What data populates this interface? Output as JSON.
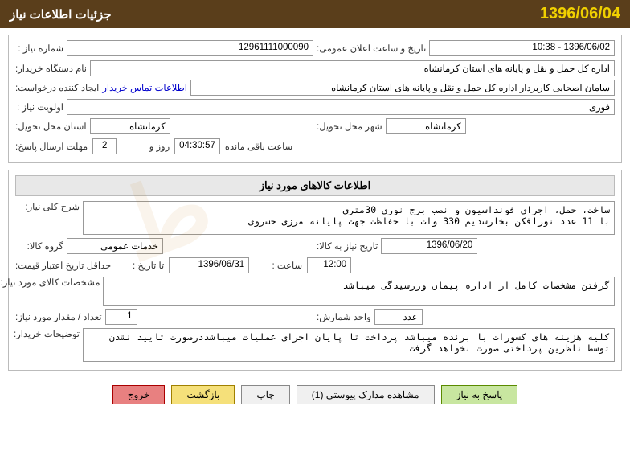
{
  "header": {
    "date": "1396/06/04",
    "title": "جزئیات اطلاعات نیاز"
  },
  "topSection": {
    "shomareNiaz_label": "شماره نیاز :",
    "shomareNiaz_value": "12961111000090",
    "tarikhAelan_label": "تاریخ و ساعت اعلان عمومی:",
    "tarikhAelan_value": "1396/06/02 - 10:38",
    "namDastgah_label": "نام دستگاه خریدار:",
    "namDastgah_value": "اداره کل حمل و نقل و پایانه های استان کرمانشاه",
    "ijadKonnande_label": "ایجاد کننده درخواست:",
    "ijadKonnande_link": "اطلاعات تماس خریدار",
    "ijadKonnande_value": "سامان اصحابی کاربردار اداره کل حمل و نقل و پایانه های استان کرمانشاه",
    "owlovat_label": "اولویت نیاز :",
    "owlovat_value": "فوری",
    "ostan_label": "استان محل تحویل:",
    "ostan_value": "کرمانشاه",
    "shahr_label": "شهر محل تحویل:",
    "shahr_value": "کرمانشاه",
    "mohlat_label": "مهلت ارسال پاسخ:",
    "mohlat_roz": "2",
    "mohlat_roz_label": "روز و",
    "mohlat_saat": "04:30:57",
    "mohlat_saat_label": "ساعت باقی مانده"
  },
  "kalaSection": {
    "title": "اطلاعات کالاهای مورد نیاز",
    "sharhKoli_label": "شرح کلی نیاز:",
    "sharhKoli_value": "ساخت، حمل، اجرای فونداسیون و نصب برج نوری 30متری\nبا 11 عدد نورافکن بخارسدیم 330 وات با حفاظت جهت پایانه مرزی حسروی",
    "goroheKala_label": "گروه کالا:",
    "goroheKala_value": "خدمات عمومی",
    "tarikh_niaz_label": "تاریخ نیاز به کالا:",
    "tarikh_niaz_value": "1396/06/20",
    "hadaqal_label": "حداقل تاریخ اعتبار قیمت:",
    "hadaqal_ta_label": "تا تاریخ :",
    "hadaqal_ta_value": "1396/06/31",
    "hadaqal_saat_label": "ساعت :",
    "hadaqal_saat_value": "12:00",
    "moshakhasat_label": "مشخصات کالای مورد نیاز:",
    "moshakhasat_value": "گرفتن مشخصات کامل از اداره پیمان وررسیدگی میباشد",
    "tedadMoord_label": "تعداد / مقدار مورد نیاز:",
    "tedadMoord_value": "1",
    "vahed_label": "واحد شمارش:",
    "vahed_value": "عدد",
    "towzih_label": "توضیحات خریدار:",
    "towzih_value": "کلیه هزینه های کسورات با برنده میباشد پرداخت تا پایان اجرای عملیات میباشددرصورت تایید نشدن\nتوسط ناظرین پرداختی صورت نخواهد گرفت"
  },
  "buttons": {
    "pasokh": "پاسخ به نیاز",
    "moshahedeh": "مشاهده مدارک پیوستی (1)",
    "chap": "چاپ",
    "bazgasht": "بازگشت",
    "khoroj": "خروج"
  }
}
